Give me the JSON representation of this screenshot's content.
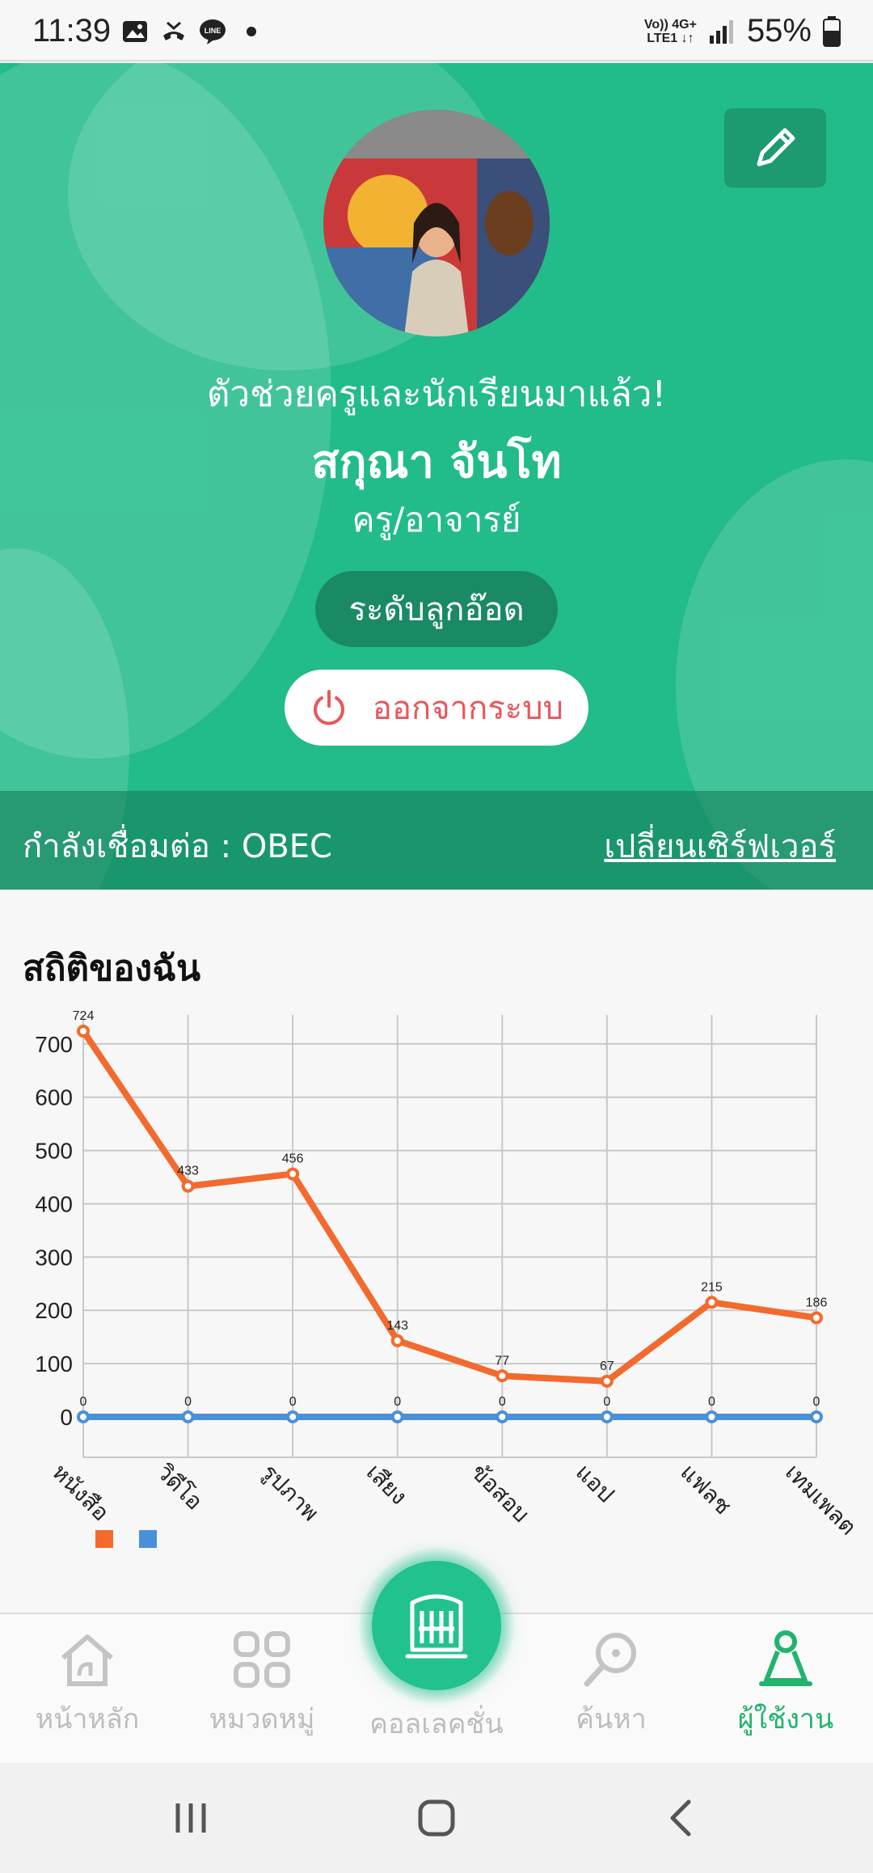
{
  "status_bar": {
    "time": "11:39",
    "network_top": "Vo)) 4G+",
    "network_bottom": "LTE1 ↓↑",
    "battery": "55%"
  },
  "profile": {
    "greeting": "ตัวช่วยครูและนักเรียนมาแล้ว!",
    "name": "สกุณา จันโท",
    "role": "ครู/อาจารย์",
    "level": "ระดับลูกอ๊อด",
    "logout_label": "ออกจากระบบ"
  },
  "server": {
    "status": "กำลังเชื่อมต่อ : OBEC",
    "change_label": "เปลี่ยนเซิร์ฟเวอร์"
  },
  "stats": {
    "title": "สถิติของฉัน"
  },
  "chart_data": {
    "type": "line",
    "categories": [
      "หนังสือ",
      "วิดีโอ",
      "รูปภาพ",
      "เสียง",
      "ข้อสอบ",
      "แอป",
      "แฟลช",
      "เทมเพลต"
    ],
    "series": [
      {
        "values": [
          724,
          433,
          456,
          143,
          77,
          67,
          215,
          186
        ],
        "color": "#f26a2e"
      },
      {
        "values": [
          0,
          0,
          0,
          0,
          0,
          0,
          0,
          0
        ],
        "color": "#4a90d9"
      }
    ],
    "y_ticks": [
      0,
      100,
      200,
      300,
      400,
      500,
      600,
      700
    ],
    "ylim": [
      0,
      724
    ],
    "grid": true,
    "legend": "bottom-left"
  },
  "bottom_nav": {
    "items": [
      {
        "label": "หน้าหลัก",
        "icon": "home-icon"
      },
      {
        "label": "หมวดหมู่",
        "icon": "category-icon"
      },
      {
        "label": "คอลเลคชั่น",
        "icon": "collection-icon"
      },
      {
        "label": "ค้นหา",
        "icon": "search-icon"
      },
      {
        "label": "ผู้ใช้งาน",
        "icon": "user-icon"
      }
    ]
  },
  "colors": {
    "brand_green": "#22bb8a",
    "active_nav": "#22b36f",
    "logout_red": "#e9565c"
  }
}
